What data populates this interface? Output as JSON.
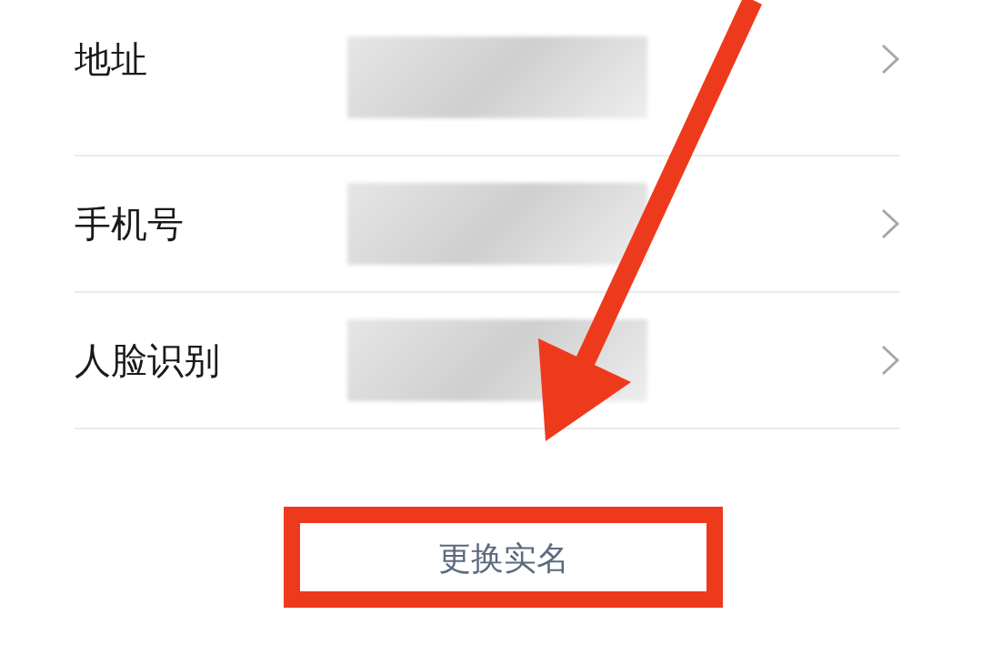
{
  "rows": [
    {
      "label": "地址"
    },
    {
      "label": "手机号"
    },
    {
      "label": "人脸识别"
    }
  ],
  "action_button": {
    "label": "更换实名"
  }
}
